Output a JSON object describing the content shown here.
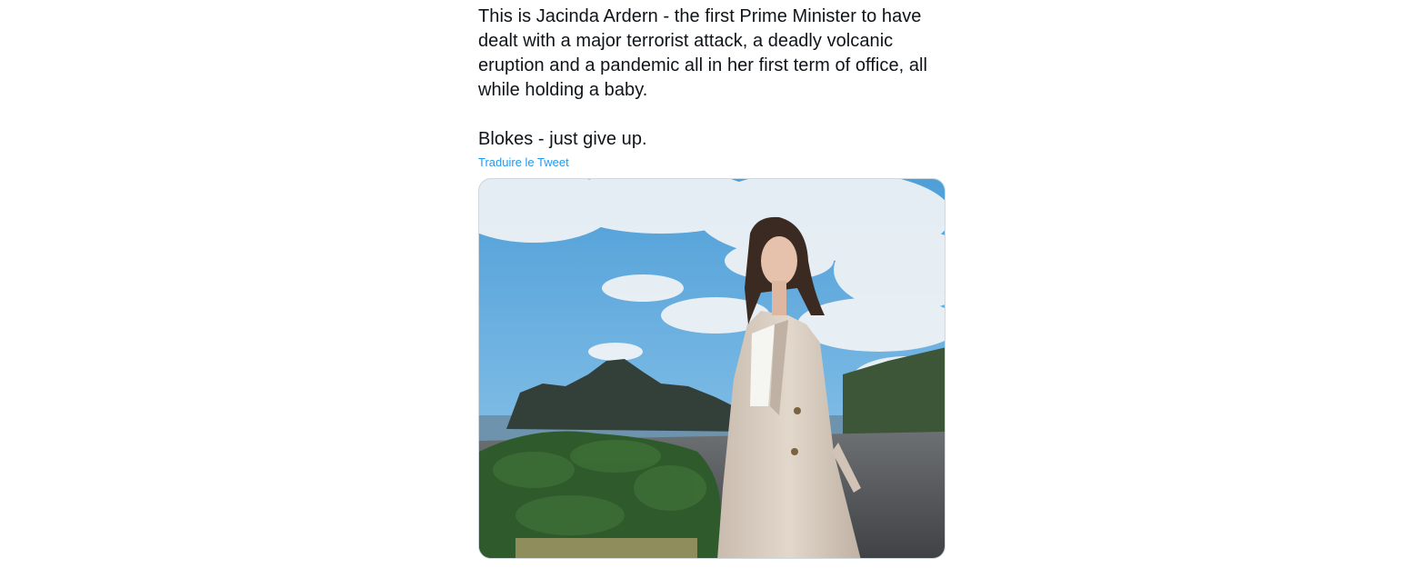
{
  "tweet": {
    "paragraphs": [
      "This is Jacinda Ardern - the first Prime Minister to have dealt with a major terrorist attack, a deadly volcanic eruption and a pandemic all in her first term of office, all while holding a baby.",
      "Blokes - just give up."
    ],
    "translate_label": "Traduire le Tweet"
  },
  "media": {
    "colors": {
      "sky": "#5aa8dc",
      "cloud": "#eef2f6",
      "headland": "#33403a",
      "bush": "#2f5a2c",
      "sand": "#54565a",
      "coat": "#d8ccbf",
      "trousers": "#7fa6b0",
      "hair": "#3a2a22"
    }
  }
}
